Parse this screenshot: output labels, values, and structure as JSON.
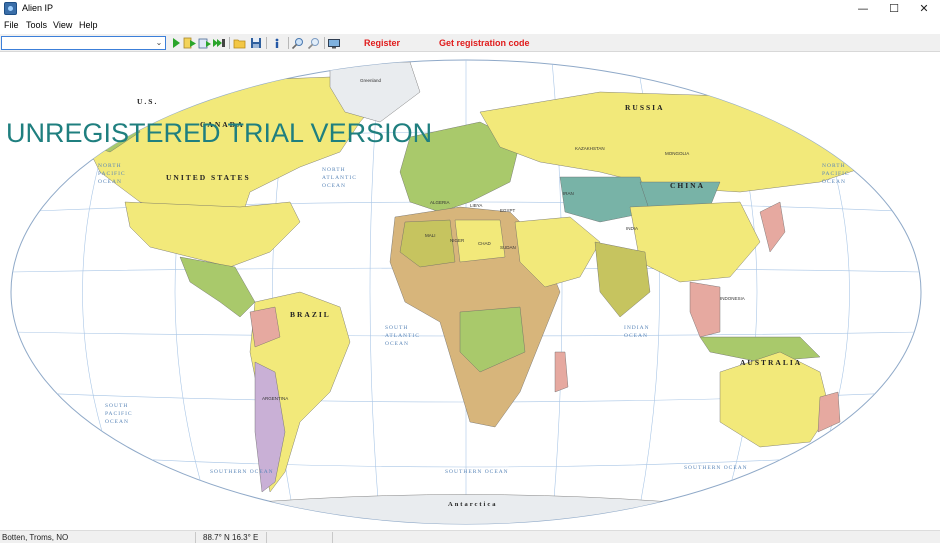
{
  "window": {
    "title": "Alien IP",
    "minimize_glyph": "—",
    "maximize_glyph": "☐",
    "close_glyph": "✕"
  },
  "menu": {
    "items": [
      "File",
      "Tools",
      "View",
      "Help"
    ]
  },
  "toolbar": {
    "address_value": "",
    "dropdown_glyph": "⌄",
    "buttons": [
      {
        "name": "trace-button",
        "icon": "play-icon"
      },
      {
        "name": "trace-list-button",
        "icon": "list-play-icon"
      },
      {
        "name": "trace-file-button",
        "icon": "file-play-icon"
      },
      {
        "name": "trace-all-button",
        "icon": "multi-play-icon"
      },
      {
        "name": "open-button",
        "icon": "folder-open-icon"
      },
      {
        "name": "save-button",
        "icon": "floppy-disk-icon"
      },
      {
        "name": "info-button",
        "icon": "info-icon"
      },
      {
        "name": "zoom-in-button",
        "icon": "zoom-in-icon"
      },
      {
        "name": "zoom-out-button",
        "icon": "zoom-out-icon"
      },
      {
        "name": "screenshot-button",
        "icon": "monitor-icon"
      }
    ],
    "register_label": "Register",
    "get_code_label": "Get registration code",
    "register_color": "#e01b1b"
  },
  "map": {
    "watermark": "UNREGISTERED TRIAL VERSION",
    "watermark_color": "#1f7f7f",
    "ocean_color": "#ffffff",
    "graticule_color": "#a9c6e6",
    "ocean_labels": {
      "north_pacific_left": [
        "NORTH",
        "PACIFIC",
        "OCEAN"
      ],
      "north_atlantic": [
        "NORTH",
        "ATLANTIC",
        "OCEAN"
      ],
      "north_pacific_right": [
        "NORTH",
        "PACIFIC",
        "OCEAN"
      ],
      "south_atlantic": [
        "SOUTH",
        "ATLANTIC",
        "OCEAN"
      ],
      "indian": [
        "INDIAN",
        "OCEAN"
      ],
      "south_pacific_left": [
        "SOUTH",
        "PACIFIC",
        "OCEAN"
      ],
      "southern_ocean_left": "SOUTHERN OCEAN",
      "southern_ocean_mid": "SOUTHERN OCEAN",
      "southern_ocean_right": "SOUTHERN OCEAN"
    },
    "country_labels": {
      "russia": "RUSSIA",
      "canada": "CANADA",
      "us_left": "U.S.",
      "united_states": "UNITED STATES",
      "china": "CHINA",
      "brazil": "BRAZIL",
      "australia": "AUSTRALIA",
      "india": "INDIA",
      "antarctica": "Antarctica",
      "algeria": "ALGERIA",
      "libya": "LIBYA",
      "egypt": "EGYPT",
      "iran": "IRAN",
      "kazakhstan": "KAZAKHSTAN",
      "mongolia": "MONGOLIA",
      "argentina": "ARGENTINA",
      "indonesia": "INDONESIA",
      "sudan": "SUDAN",
      "chad": "CHAD",
      "niger": "NIGER",
      "mali": "MALI",
      "greenland": "Greenland"
    },
    "colors": {
      "land_yellow": "#f2e97a",
      "land_green": "#a9c96b",
      "land_olive": "#c6c45f",
      "land_pink": "#e6a9a0",
      "land_tan": "#d7b57b",
      "land_lavender": "#c9b0d6",
      "land_teal": "#78b3a7",
      "land_blue": "#9fc5e0",
      "land_grey": "#e9ecef"
    }
  },
  "status": {
    "location": "Botten, Troms, NO",
    "coordinates": "88.7° N 16.3° E"
  }
}
